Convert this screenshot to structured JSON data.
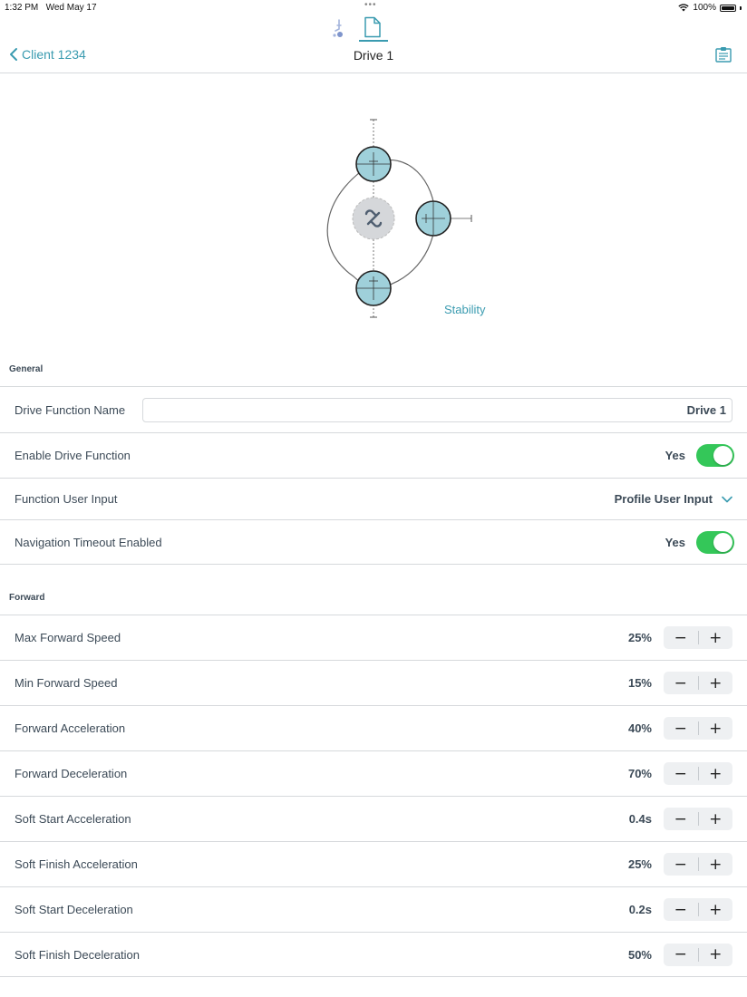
{
  "status_bar": {
    "time": "1:32 PM",
    "date": "Wed May 17",
    "battery": "100%",
    "dots": "•••"
  },
  "nav": {
    "back_label": "Client 1234",
    "title": "Drive 1"
  },
  "diagram": {
    "stability_label": "Stability"
  },
  "colors": {
    "accent": "#3a9bb0",
    "toggle_on": "#34c759",
    "wheel_fill": "#9fd0da"
  },
  "general": {
    "header": "General",
    "drive_function_name": {
      "label": "Drive Function Name",
      "value": "Drive 1"
    },
    "enable_drive_function": {
      "label": "Enable Drive Function",
      "value": "Yes",
      "on": true
    },
    "function_user_input": {
      "label": "Function User Input",
      "value": "Profile User Input"
    },
    "navigation_timeout": {
      "label": "Navigation Timeout Enabled",
      "value": "Yes",
      "on": true
    }
  },
  "forward": {
    "header": "Forward",
    "rows": [
      {
        "label": "Max Forward Speed",
        "value": "25%"
      },
      {
        "label": "Min Forward Speed",
        "value": "15%"
      },
      {
        "label": "Forward Acceleration",
        "value": "40%"
      },
      {
        "label": "Forward Deceleration",
        "value": "70%"
      },
      {
        "label": "Soft Start Acceleration",
        "value": "0.4s"
      },
      {
        "label": "Soft Finish Acceleration",
        "value": "25%"
      },
      {
        "label": "Soft Start Deceleration",
        "value": "0.2s"
      },
      {
        "label": "Soft Finish Deceleration",
        "value": "50%"
      }
    ]
  },
  "stepper": {
    "minus": "−",
    "plus": "+"
  }
}
